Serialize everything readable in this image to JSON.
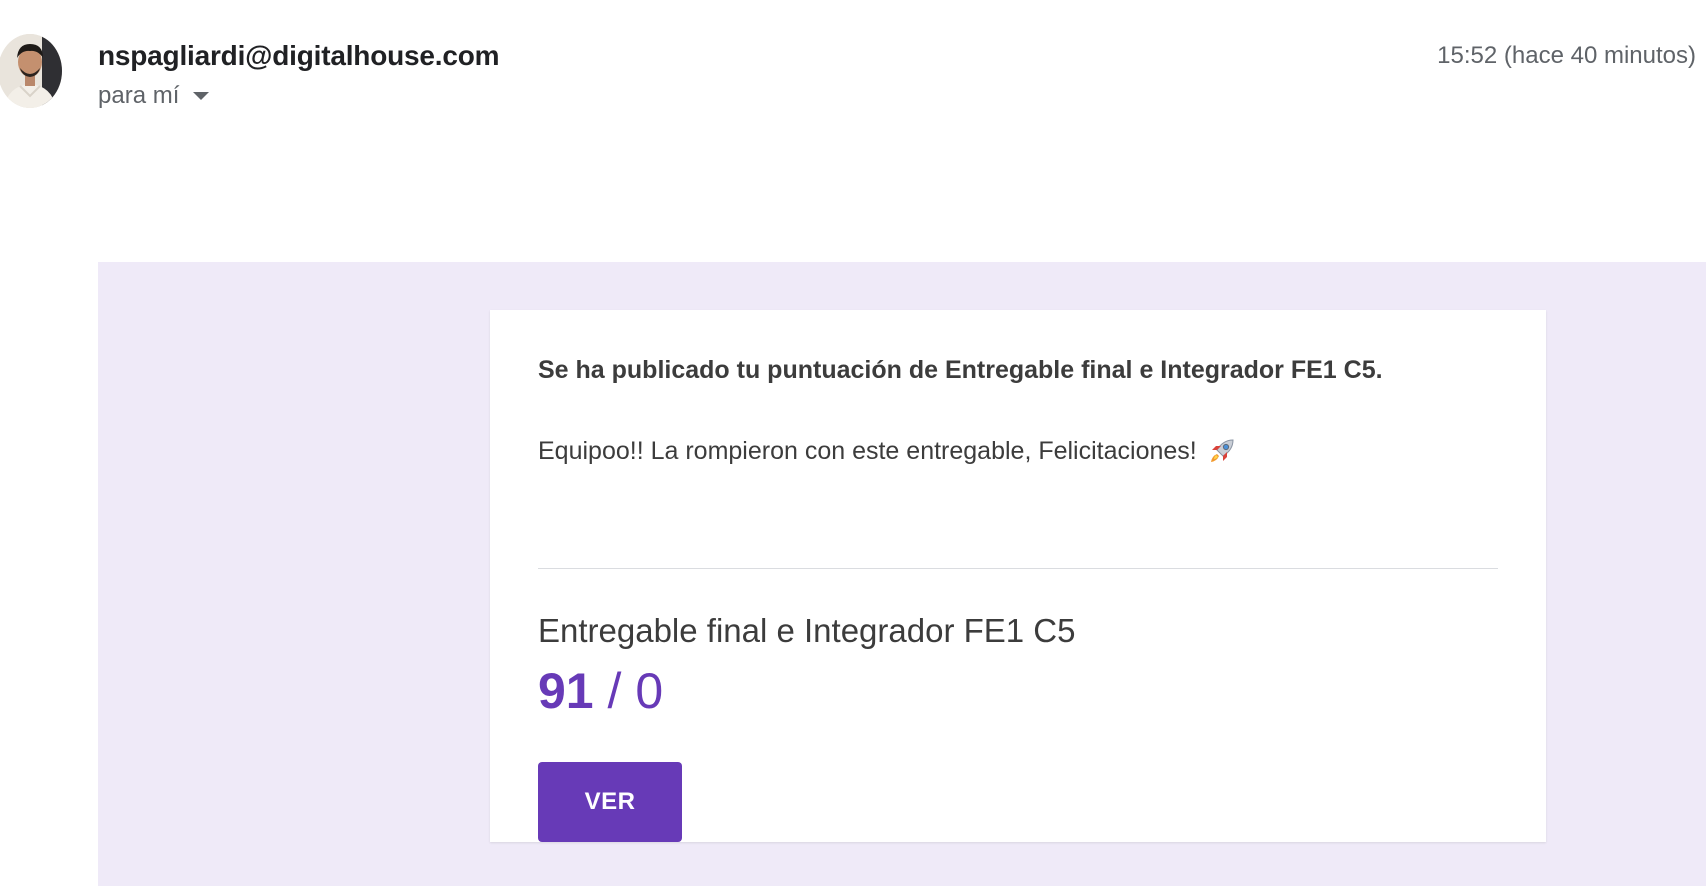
{
  "header": {
    "avatar_icon": "user-avatar",
    "sender": "nspagliardi@digitalhouse.com",
    "recipient": "para mí",
    "timestamp": "15:52 (hace 40 minutos)"
  },
  "card": {
    "headline": "Se ha publicado tu puntuación de Entregable final e Integrador FE1 C5.",
    "message": "Equipoo!! La rompieron con este entregable, Felicitaciones!",
    "message_icon": "rocket-icon",
    "assignment_title": "Entregable final e Integrador FE1 C5",
    "score_obtained": "91",
    "score_separator": " / ",
    "score_total": "0",
    "button_label": "VER"
  },
  "colors": {
    "accent": "#673ab7",
    "body_background": "#efeaf8"
  }
}
